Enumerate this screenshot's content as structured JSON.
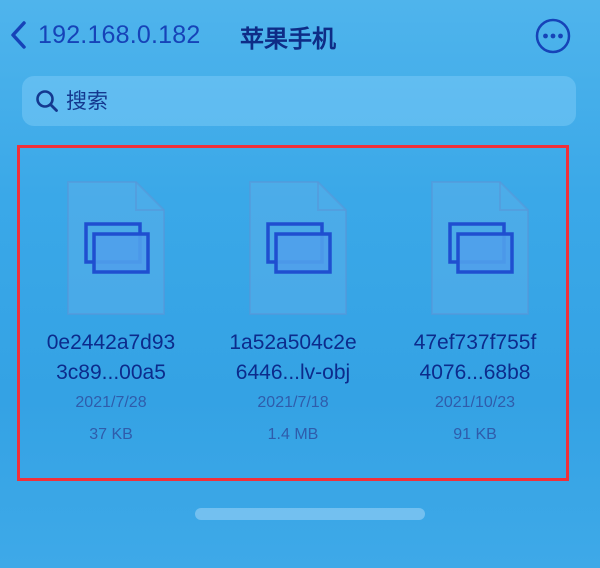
{
  "nav": {
    "back_label": "192.168.0.182",
    "title": "苹果手机"
  },
  "search": {
    "placeholder": "搜索"
  },
  "files": [
    {
      "name_line1": "0e2442a7d93",
      "name_line2": "3c89...00a5",
      "date": "2021/7/28",
      "size": "37 KB"
    },
    {
      "name_line1": "1a52a504c2e",
      "name_line2": "6446...lv-obj",
      "date": "2021/7/18",
      "size": "1.4 MB"
    },
    {
      "name_line1": "47ef737f755f",
      "name_line2": "4076...68b8",
      "date": "2021/10/23",
      "size": "91 KB"
    }
  ],
  "icons": {
    "back": "chevron-left-icon",
    "more": "ellipsis-circle-icon",
    "search": "search-icon",
    "file": "document-icon"
  },
  "colors": {
    "background": "#3aa8e8",
    "text_primary": "#0e2c86",
    "selection_border": "#f0303a"
  }
}
